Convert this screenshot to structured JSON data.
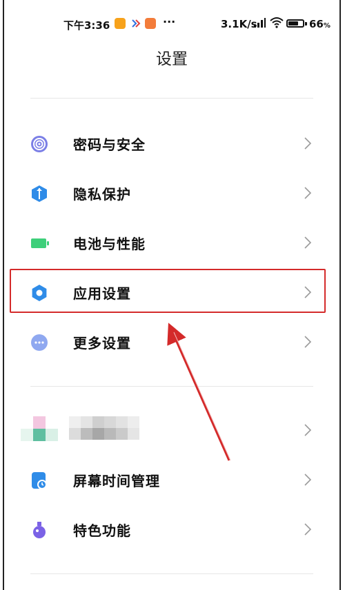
{
  "status_bar": {
    "time": "下午3:36",
    "more": "···",
    "net_speed": "3.1K/s",
    "battery": "66",
    "battery_unit": "%"
  },
  "header": {
    "title": "设置"
  },
  "menu": {
    "items": [
      {
        "label": "密码与安全",
        "icon": "fingerprint-icon",
        "color": "#7b7fe6"
      },
      {
        "label": "隐私保护",
        "icon": "privacy-shield-icon",
        "color": "#2f8ce8"
      },
      {
        "label": "电池与性能",
        "icon": "battery-icon",
        "color": "#3ecf7a"
      },
      {
        "label": "应用设置",
        "icon": "gear-icon",
        "color": "#2f8ce8"
      },
      {
        "label": "更多设置",
        "icon": "more-dots-icon",
        "color": "#8fa8f0"
      }
    ],
    "items2": [
      {
        "label": "屏幕时间管理",
        "icon": "screen-time-icon",
        "color": "#2f8ce8"
      },
      {
        "label": "特色功能",
        "icon": "flask-icon",
        "color": "#7b62e6"
      }
    ]
  },
  "annotation": {
    "highlight_color": "#d42a2a"
  }
}
